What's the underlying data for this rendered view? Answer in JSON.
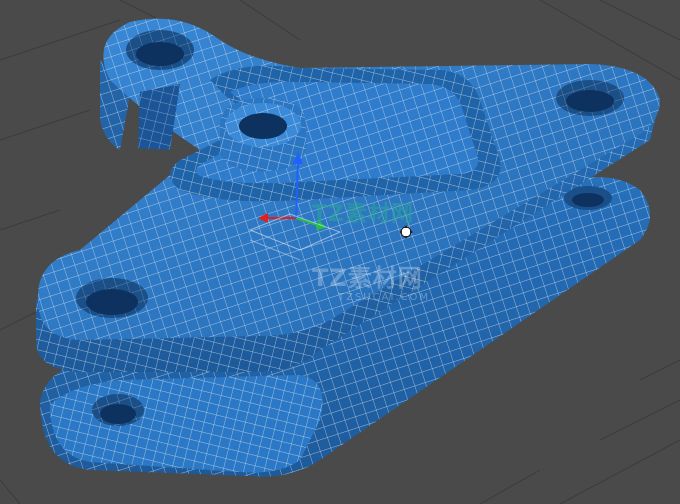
{
  "viewport": {
    "background": "#4a4a4a",
    "grid_color": "#3a3a3a",
    "object": "triangular bracket mesh with wireframe",
    "mesh_color": "#2a78c4",
    "wire_color": "#e8eef6"
  },
  "gizmo": {
    "icon": "move-transform-gizmo",
    "axis_colors": {
      "x": "#e02020",
      "y": "#20c040",
      "z": "#2060ff"
    }
  },
  "cursor": {
    "icon": "move-cursor-icon"
  },
  "watermarks": {
    "logo_text_1": "TZ素材网",
    "logo_text_2": "TZ素材网",
    "url_text": "TZSUCAI.COM"
  }
}
